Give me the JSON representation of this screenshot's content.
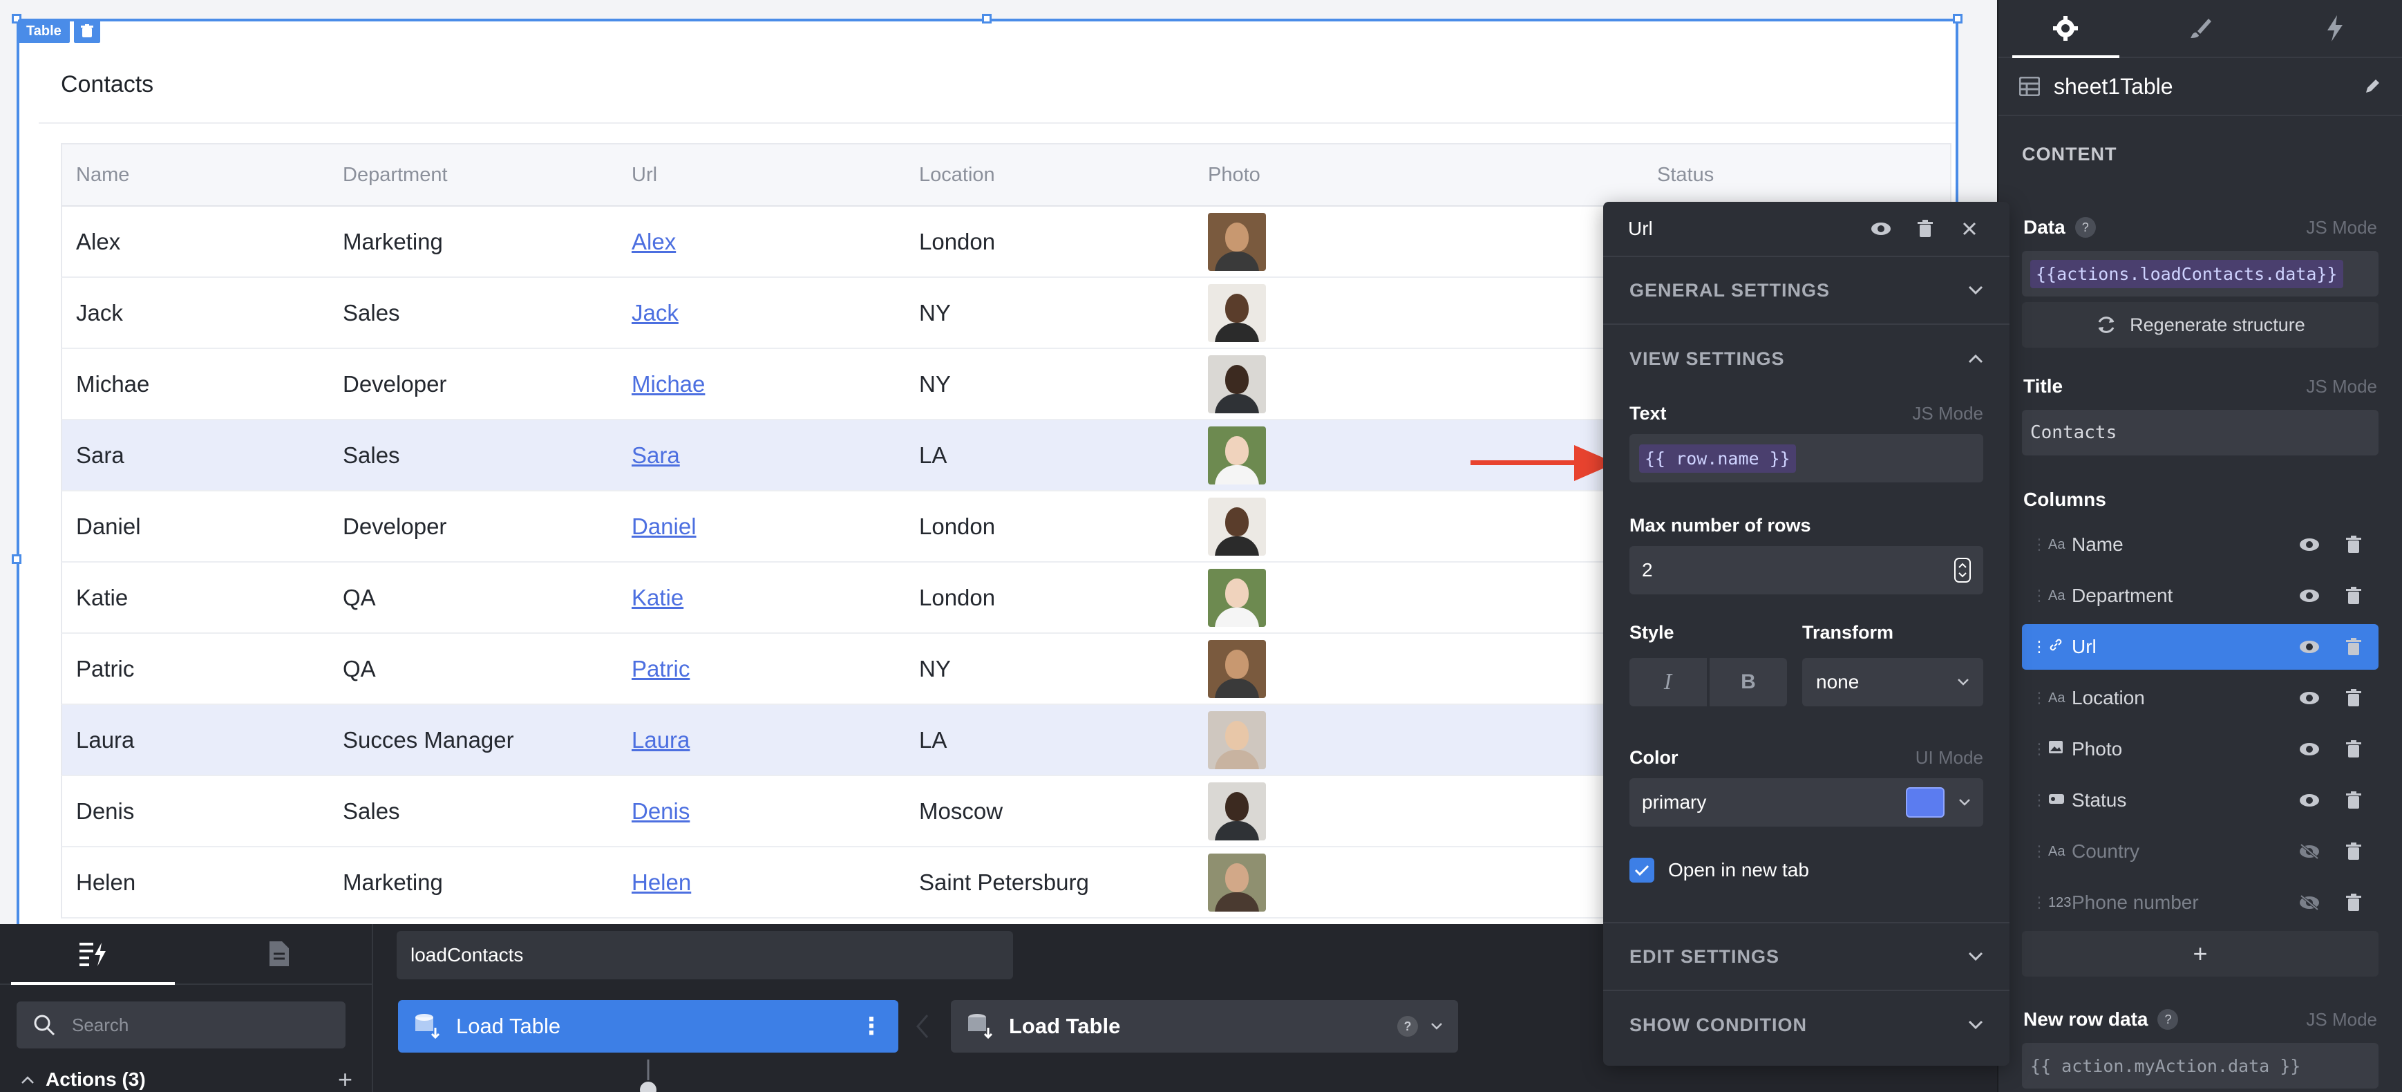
{
  "widget": {
    "tag": "Table",
    "title": "Contacts"
  },
  "table": {
    "columns": [
      "Name",
      "Department",
      "Url",
      "Location",
      "Photo",
      "Status"
    ],
    "rows": [
      {
        "name": "Alex",
        "department": "Marketing",
        "url": "Alex",
        "location": "London",
        "highlight": false
      },
      {
        "name": "Jack",
        "department": "Sales",
        "url": "Jack",
        "location": "NY",
        "highlight": false
      },
      {
        "name": "Michae",
        "department": "Developer",
        "url": "Michae",
        "location": "NY",
        "highlight": false
      },
      {
        "name": "Sara",
        "department": "Sales",
        "url": "Sara",
        "location": "LA",
        "highlight": true
      },
      {
        "name": "Daniel",
        "department": "Developer",
        "url": "Daniel",
        "location": "London",
        "highlight": false
      },
      {
        "name": "Katie",
        "department": "QA",
        "url": "Katie",
        "location": "London",
        "highlight": false
      },
      {
        "name": "Patric",
        "department": "QA",
        "url": "Patric",
        "location": "NY",
        "highlight": false
      },
      {
        "name": "Laura",
        "department": "Succes Manager",
        "url": "Laura",
        "location": "LA",
        "highlight": true
      },
      {
        "name": "Denis",
        "department": "Sales",
        "url": "Denis",
        "location": "Moscow",
        "highlight": false
      },
      {
        "name": "Helen",
        "department": "Marketing",
        "url": "Helen",
        "location": "Saint Petersburg",
        "highlight": false
      }
    ]
  },
  "right_panel": {
    "component_name": "sheet1Table",
    "section": "CONTENT",
    "data_label": "Data",
    "js_mode": "JS Mode",
    "data_value": "{{actions.loadContacts.data}}",
    "regenerate": "Regenerate structure",
    "title_label": "Title",
    "title_value": "Contacts",
    "columns_label": "Columns",
    "columns": [
      {
        "type": "Aa",
        "name": "Name",
        "visible": true
      },
      {
        "type": "Aa",
        "name": "Department",
        "visible": true
      },
      {
        "type": "link",
        "name": "Url",
        "visible": true
      },
      {
        "type": "Aa",
        "name": "Location",
        "visible": true
      },
      {
        "type": "img",
        "name": "Photo",
        "visible": true
      },
      {
        "type": "tag",
        "name": "Status",
        "visible": true
      },
      {
        "type": "Aa",
        "name": "Country",
        "visible": false
      },
      {
        "type": "123",
        "name": "Phone number",
        "visible": false
      }
    ],
    "add_label": "+",
    "new_row_label": "New row data",
    "new_row_value": "{{ action.myAction.data }}"
  },
  "popup": {
    "title": "Url",
    "general": "GENERAL SETTINGS",
    "view": "VIEW SETTINGS",
    "text_label": "Text",
    "js_mode": "JS Mode",
    "text_value": "{{ row.name }}",
    "max_rows_label": "Max number of rows",
    "max_rows_value": "2",
    "style_label": "Style",
    "italic": "I",
    "bold": "B",
    "transform_label": "Transform",
    "transform_value": "none",
    "color_label": "Color",
    "ui_mode": "UI Mode",
    "color_value": "primary",
    "color_swatch": "#5b7cf0",
    "open_new_tab": "Open in new tab",
    "edit": "EDIT SETTINGS",
    "show_condition": "SHOW CONDITION"
  },
  "bottom": {
    "search_placeholder": "Search",
    "actions_label": "Actions (3)",
    "query_name": "loadContacts",
    "step_active": "Load Table",
    "step_next": "Load Table"
  }
}
